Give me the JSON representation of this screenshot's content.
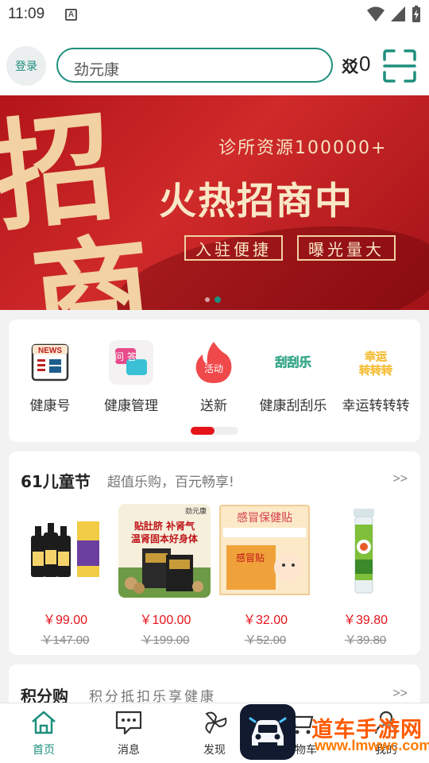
{
  "status_bar": {
    "time": "11:09",
    "notification_icon": "A"
  },
  "header": {
    "login_label": "登录",
    "search_value": "劲元康",
    "coin_symbol": "㸚",
    "coin_count": "0"
  },
  "banner": {
    "big_chars": [
      "招",
      "商"
    ],
    "subtitle": "诊所资源100000+",
    "title": "火热招商中",
    "tags": [
      "入驻便捷",
      "曝光量大"
    ],
    "active_dot": 1
  },
  "quick_menu": {
    "items": [
      {
        "label": "健康号",
        "icon": "news-icon",
        "icon_text": "NEWS"
      },
      {
        "label": "健康管理",
        "icon": "health-qa-icon",
        "icon_text": "问 答"
      },
      {
        "label": "送新",
        "icon": "activity-flame-icon",
        "icon_text": "活动"
      },
      {
        "label": "健康刮刮乐",
        "icon": "scratch-card-icon",
        "icon_text": "刮刮乐"
      },
      {
        "label": "幸运转转转",
        "icon": "lucky-wheel-icon",
        "icon_text": "幸运 转转转"
      }
    ],
    "page_progress": 0.5
  },
  "promo": {
    "title": "61儿童节",
    "subtitle": "超值乐购，百元畅享!",
    "more": ">>",
    "products": [
      {
        "price": "￥99.00",
        "old_price": "￥147.00",
        "image": "drops-bottles"
      },
      {
        "price": "￥100.00",
        "old_price": "￥199.00",
        "image": "navel-patch-box",
        "image_text": [
          "劲元康",
          "贴肚脐 补肾气",
          "温肾固本好身体"
        ]
      },
      {
        "price": "￥32.00",
        "old_price": "￥52.00",
        "image": "cold-patch-box",
        "image_text": [
          "感冒保健贴",
          "感冒贴"
        ]
      },
      {
        "price": "￥39.80",
        "old_price": "￥39.80",
        "image": "effervescent-tube"
      }
    ]
  },
  "points": {
    "title": "积分购",
    "subtitle": "积分抵扣乐享健康",
    "more": ">>"
  },
  "tabbar": {
    "tabs": [
      {
        "label": "首页",
        "icon": "home-icon"
      },
      {
        "label": "消息",
        "icon": "message-icon"
      },
      {
        "label": "发现",
        "icon": "discover-icon"
      },
      {
        "label": "购物车",
        "icon": "cart-icon"
      },
      {
        "label": "我的",
        "icon": "profile-icon"
      }
    ]
  },
  "watermark": {
    "title": "道车手游网",
    "url": "www.lmwwc.com"
  },
  "colors": {
    "brand": "#1f8f7e",
    "accent_red": "#e5141b",
    "banner_gold": "#f2d1a2"
  }
}
